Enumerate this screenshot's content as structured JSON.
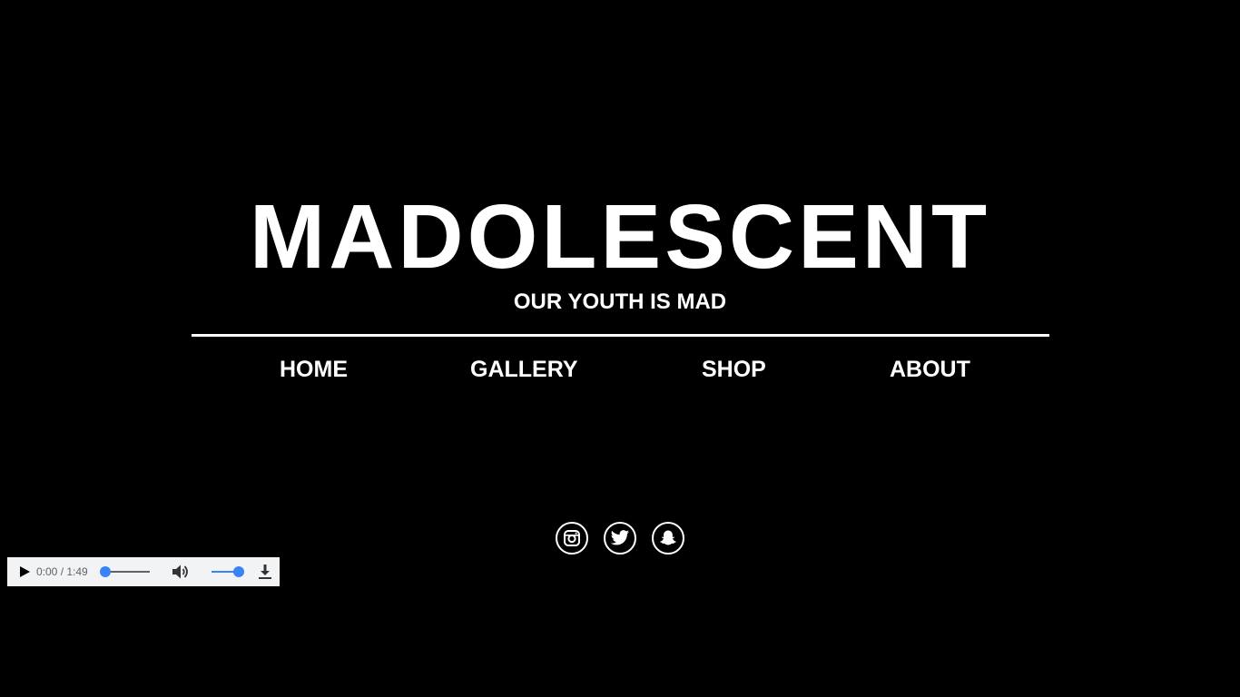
{
  "header": {
    "title": "MADOLESCENT",
    "tagline": "OUR YOUTH IS MAD"
  },
  "nav": {
    "items": [
      {
        "label": "HOME"
      },
      {
        "label": "GALLERY"
      },
      {
        "label": "SHOP"
      },
      {
        "label": "ABOUT"
      }
    ]
  },
  "social": {
    "icons": [
      "instagram-icon",
      "twitter-icon",
      "snapchat-icon"
    ]
  },
  "audio_player": {
    "time": "0:00 / 1:49",
    "progress": 0,
    "volume": 1,
    "accent_color": "#3b82f6",
    "background_color": "#f1f3f4"
  },
  "colors": {
    "background": "#000000",
    "text": "#ffffff"
  }
}
